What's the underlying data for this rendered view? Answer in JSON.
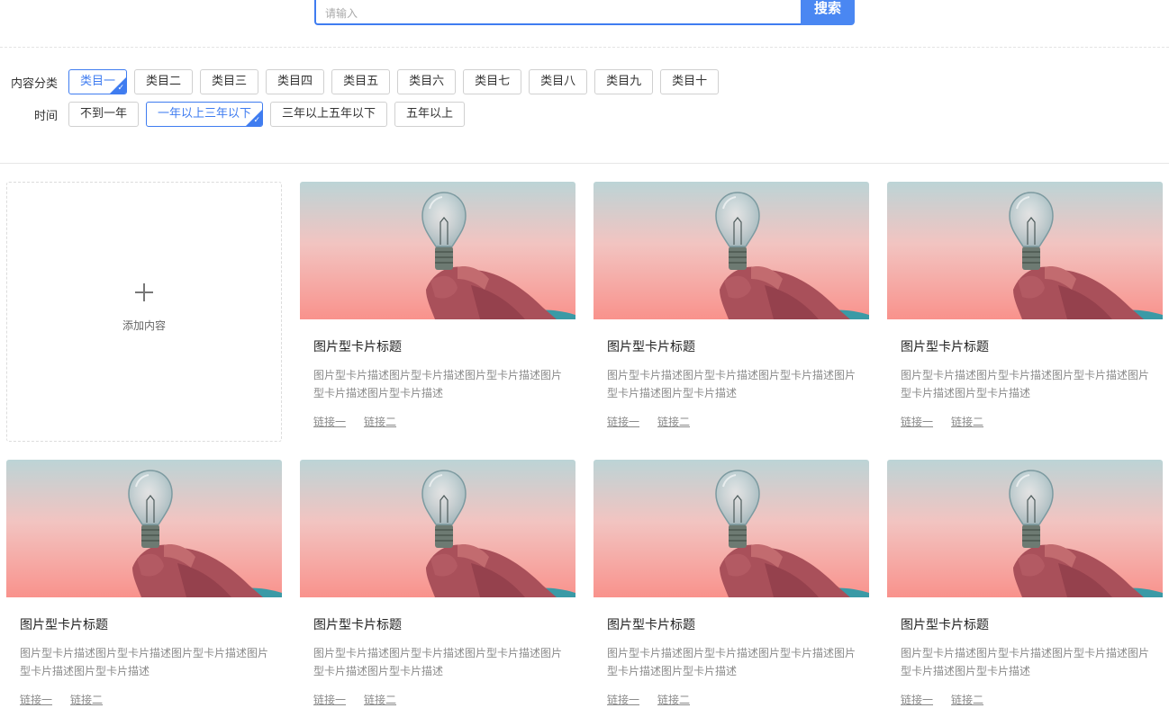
{
  "search": {
    "placeholder": "请输入",
    "button_label": "搜索"
  },
  "filters": {
    "category": {
      "label": "内容分类",
      "options": [
        "类目一",
        "类目二",
        "类目三",
        "类目四",
        "类目五",
        "类目六",
        "类目七",
        "类目八",
        "类目九",
        "类目十"
      ],
      "selected_index": 0
    },
    "time": {
      "label": "时间",
      "options": [
        "不到一年",
        "一年以上三年以下",
        "三年以上五年以下",
        "五年以上"
      ],
      "selected_index": 1
    }
  },
  "add_card": {
    "label": "添加内容"
  },
  "cards": [
    {
      "title": "图片型卡片标题",
      "desc": "图片型卡片描述图片型卡片描述图片型卡片描述图片型卡片描述图片型卡片描述",
      "links": [
        "链接一",
        "链接二"
      ]
    },
    {
      "title": "图片型卡片标题",
      "desc": "图片型卡片描述图片型卡片描述图片型卡片描述图片型卡片描述图片型卡片描述",
      "links": [
        "链接一",
        "链接二"
      ]
    },
    {
      "title": "图片型卡片标题",
      "desc": "图片型卡片描述图片型卡片描述图片型卡片描述图片型卡片描述图片型卡片描述",
      "links": [
        "链接一",
        "链接二"
      ]
    },
    {
      "title": "图片型卡片标题",
      "desc": "图片型卡片描述图片型卡片描述图片型卡片描述图片型卡片描述图片型卡片描述",
      "links": [
        "链接一",
        "链接二"
      ]
    },
    {
      "title": "图片型卡片标题",
      "desc": "图片型卡片描述图片型卡片描述图片型卡片描述图片型卡片描述图片型卡片描述",
      "links": [
        "链接一",
        "链接二"
      ]
    },
    {
      "title": "图片型卡片标题",
      "desc": "图片型卡片描述图片型卡片描述图片型卡片描述图片型卡片描述图片型卡片描述",
      "links": [
        "链接一",
        "链接二"
      ]
    },
    {
      "title": "图片型卡片标题",
      "desc": "图片型卡片描述图片型卡片描述图片型卡片描述图片型卡片描述图片型卡片描述",
      "links": [
        "链接一",
        "链接二"
      ]
    }
  ],
  "colors": {
    "accent": "#3f7cf0",
    "button": "#4a87f2"
  },
  "icons": {
    "add": "plus-icon",
    "selected": "check-icon",
    "card_image": "lightbulb-in-hand-image"
  }
}
